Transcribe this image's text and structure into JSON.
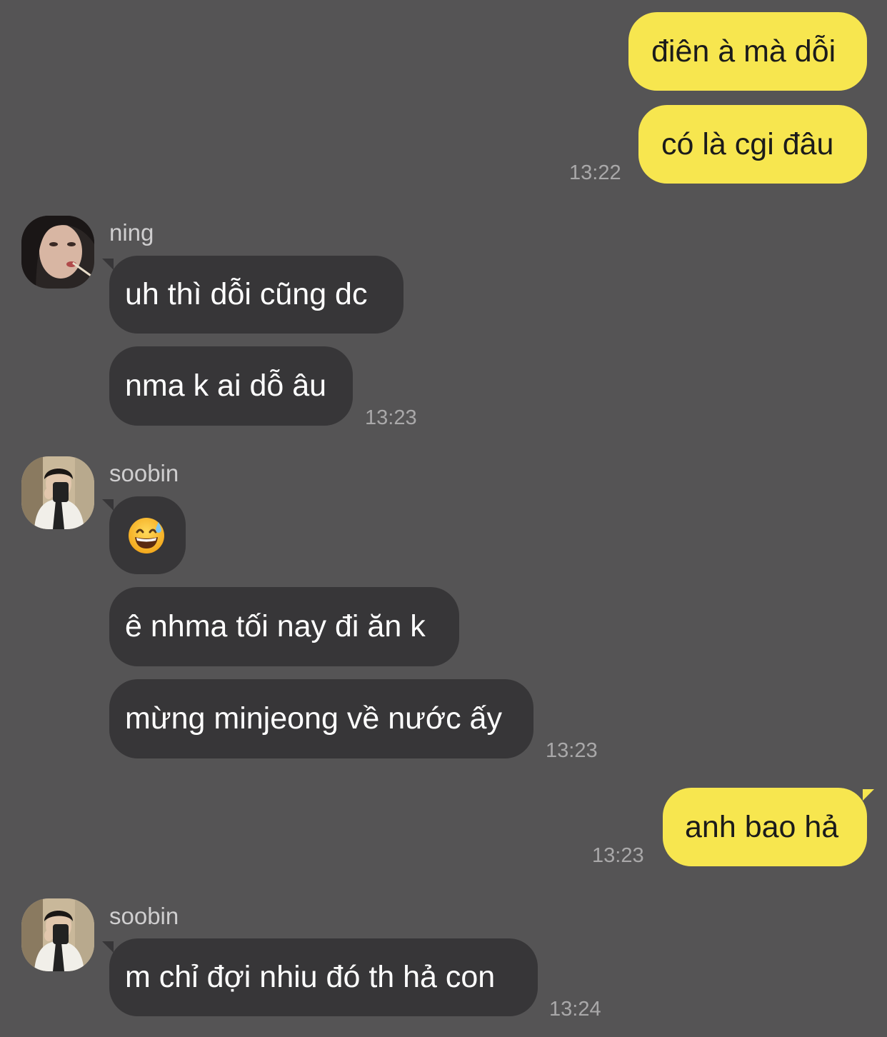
{
  "colors": {
    "background": "#555455",
    "my_bubble": "#f7e64f",
    "their_bubble": "#373638",
    "timestamp": "#a9a8a9"
  },
  "messages": {
    "m1": "điên à mà dỗi",
    "m2": "có là cgi đâu",
    "t1": "13:22",
    "sender_ning": "ning",
    "m3": "uh thì dỗi cũng dc",
    "m4": "nma k ai dỗ âu",
    "t2": "13:23",
    "sender_soobin_1": "soobin",
    "m5": "😅",
    "m6": "ê nhma tối nay đi ăn k",
    "m7": "mừng minjeong về nước ấy",
    "t3": "13:23",
    "m8": "anh bao hả",
    "t4": "13:23",
    "sender_soobin_2": "soobin",
    "m9": "m chỉ đợi nhiu đó th hả con",
    "t5": "13:24"
  },
  "icons": {
    "avatar_ning": "ning-avatar-photo",
    "avatar_soobin": "soobin-avatar-photo"
  }
}
